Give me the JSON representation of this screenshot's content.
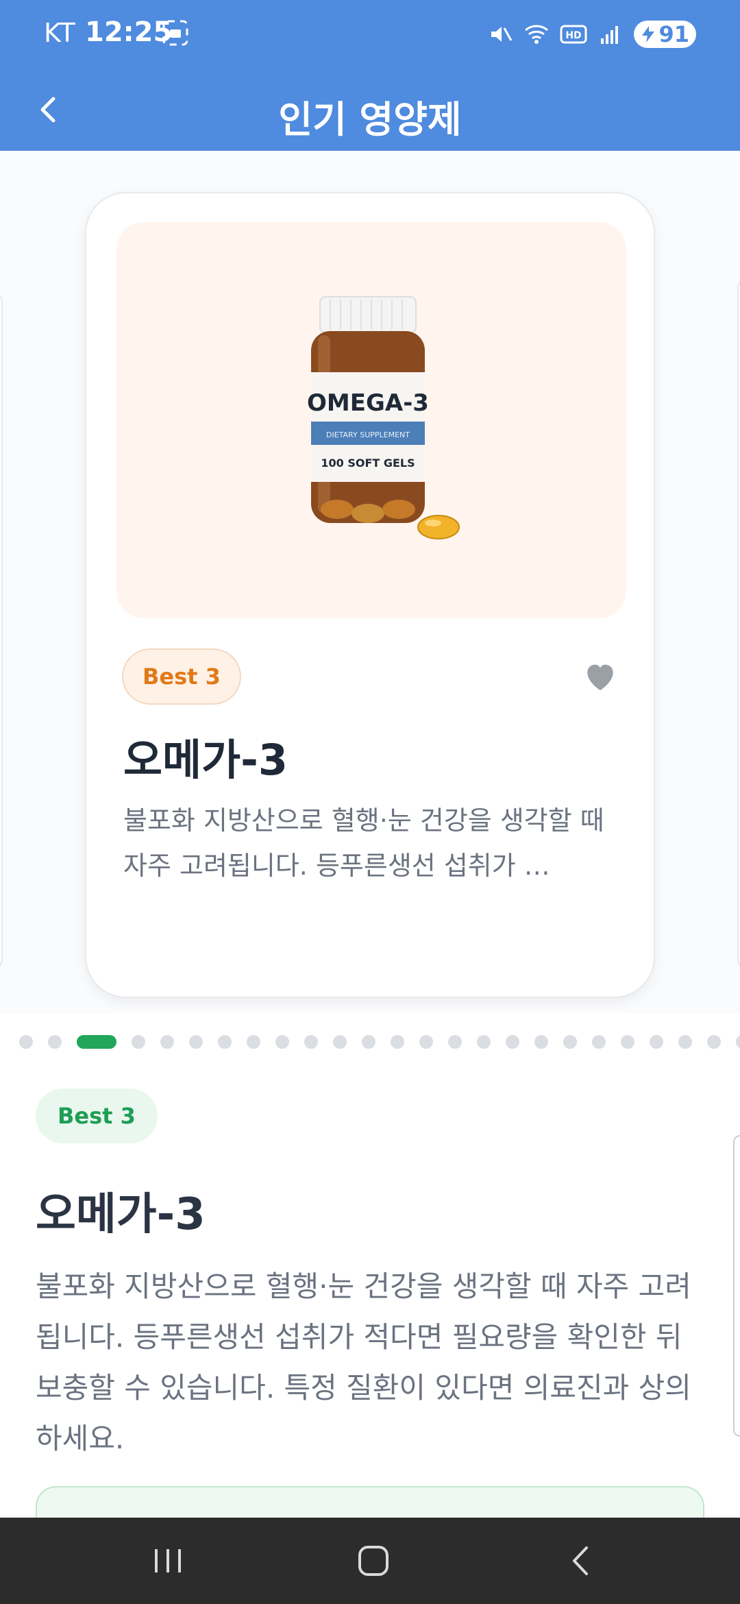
{
  "status": {
    "carrier": "KT",
    "time": "12:25",
    "battery": "91",
    "icons": [
      "screenshot-icon",
      "mute-icon",
      "wifi-icon",
      "hd-icon",
      "signal-icon",
      "battery-icon"
    ]
  },
  "appbar": {
    "title": "인기 영양제",
    "back_icon": "chevron-left-icon"
  },
  "card": {
    "badge": "Best 3",
    "title": "오메가-3",
    "description": "불포화 지방산으로 혈행·눈 건강을 생각할 때 자주 고려됩니다. 등푸른생선 섭취가 …",
    "image": {
      "brand": "OMEGA-3",
      "subtitle": "DIETARY SUPPLEMENT",
      "count": "100 SOFT GELS"
    },
    "favorite_icon": "heart-icon"
  },
  "pagination": {
    "total": 25,
    "active_index": 2
  },
  "detail": {
    "badge": "Best 3",
    "title": "오메가-3",
    "description": "불포화 지방산으로 혈행·눈 건강을 생각할 때 자주 고려됩니다. 등푸른생선 섭취가 적다면 필요량을 확인한 뒤 보충할 수 있습니다. 특정 질환이 있다면 의료진과 상의하세요."
  },
  "nav": {
    "recent": "recent-apps-icon",
    "home": "home-icon",
    "back": "back-icon"
  },
  "colors": {
    "header": "#4F8BDE",
    "accent_green": "#21A65A",
    "badge_orange": "#E07A18",
    "text_dark": "#1F2937"
  }
}
